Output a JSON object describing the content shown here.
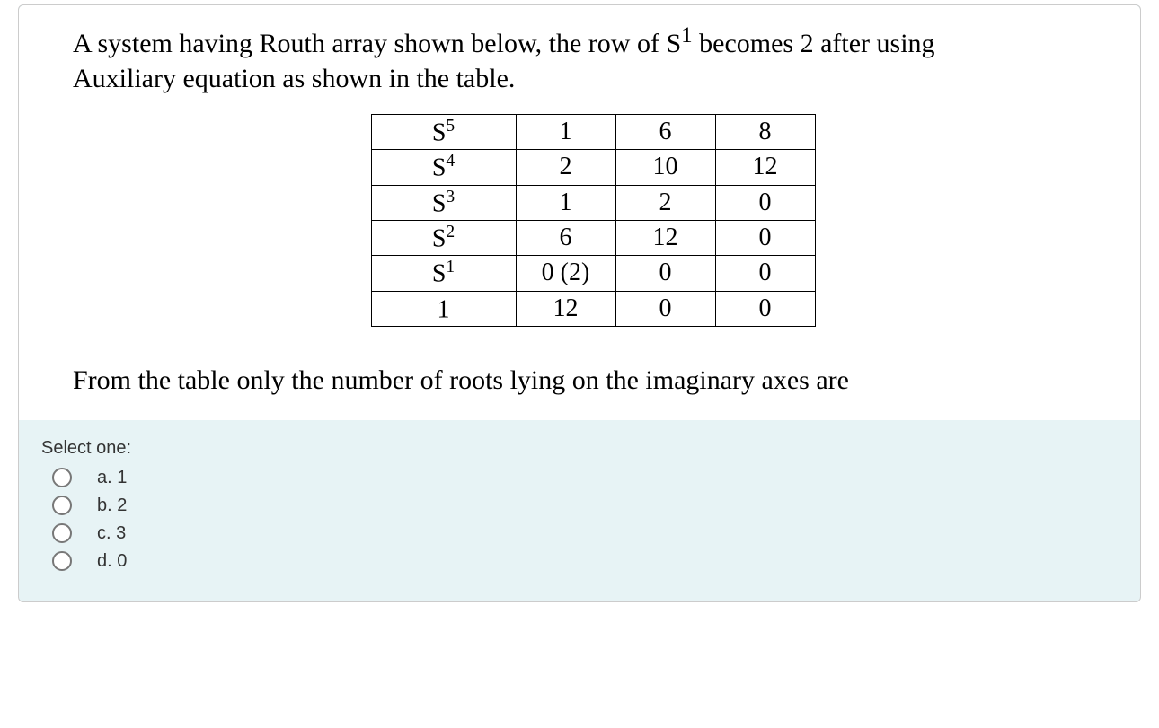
{
  "question": {
    "stem_line1": "A system having Routh array shown below, the row of S",
    "stem_sup1": "1",
    "stem_line1b": " becomes 2 after using",
    "stem_line2": "Auxiliary equation as shown in the table.",
    "stem_bottom": "From the table only the number of roots lying on the imaginary axes are"
  },
  "table": {
    "rows": [
      {
        "label_base": "S",
        "label_sup": "5",
        "c1": "1",
        "c2": "6",
        "c3": "8"
      },
      {
        "label_base": "S",
        "label_sup": "4",
        "c1": "2",
        "c2": "10",
        "c3": "12"
      },
      {
        "label_base": "S",
        "label_sup": "3",
        "c1": "1",
        "c2": "2",
        "c3": "0"
      },
      {
        "label_base": "S",
        "label_sup": "2",
        "c1": "6",
        "c2": "12",
        "c3": "0"
      },
      {
        "label_base": "S",
        "label_sup": "1",
        "c1": "0 (2)",
        "c2": "0",
        "c3": "0"
      },
      {
        "label_base": "1",
        "label_sup": "",
        "c1": "12",
        "c2": "0",
        "c3": "0"
      }
    ]
  },
  "answers": {
    "prompt": "Select one:",
    "options": [
      {
        "label": "a.",
        "text": "1"
      },
      {
        "label": "b.",
        "text": "2"
      },
      {
        "label": "c.",
        "text": "3"
      },
      {
        "label": "d.",
        "text": "0"
      }
    ]
  }
}
